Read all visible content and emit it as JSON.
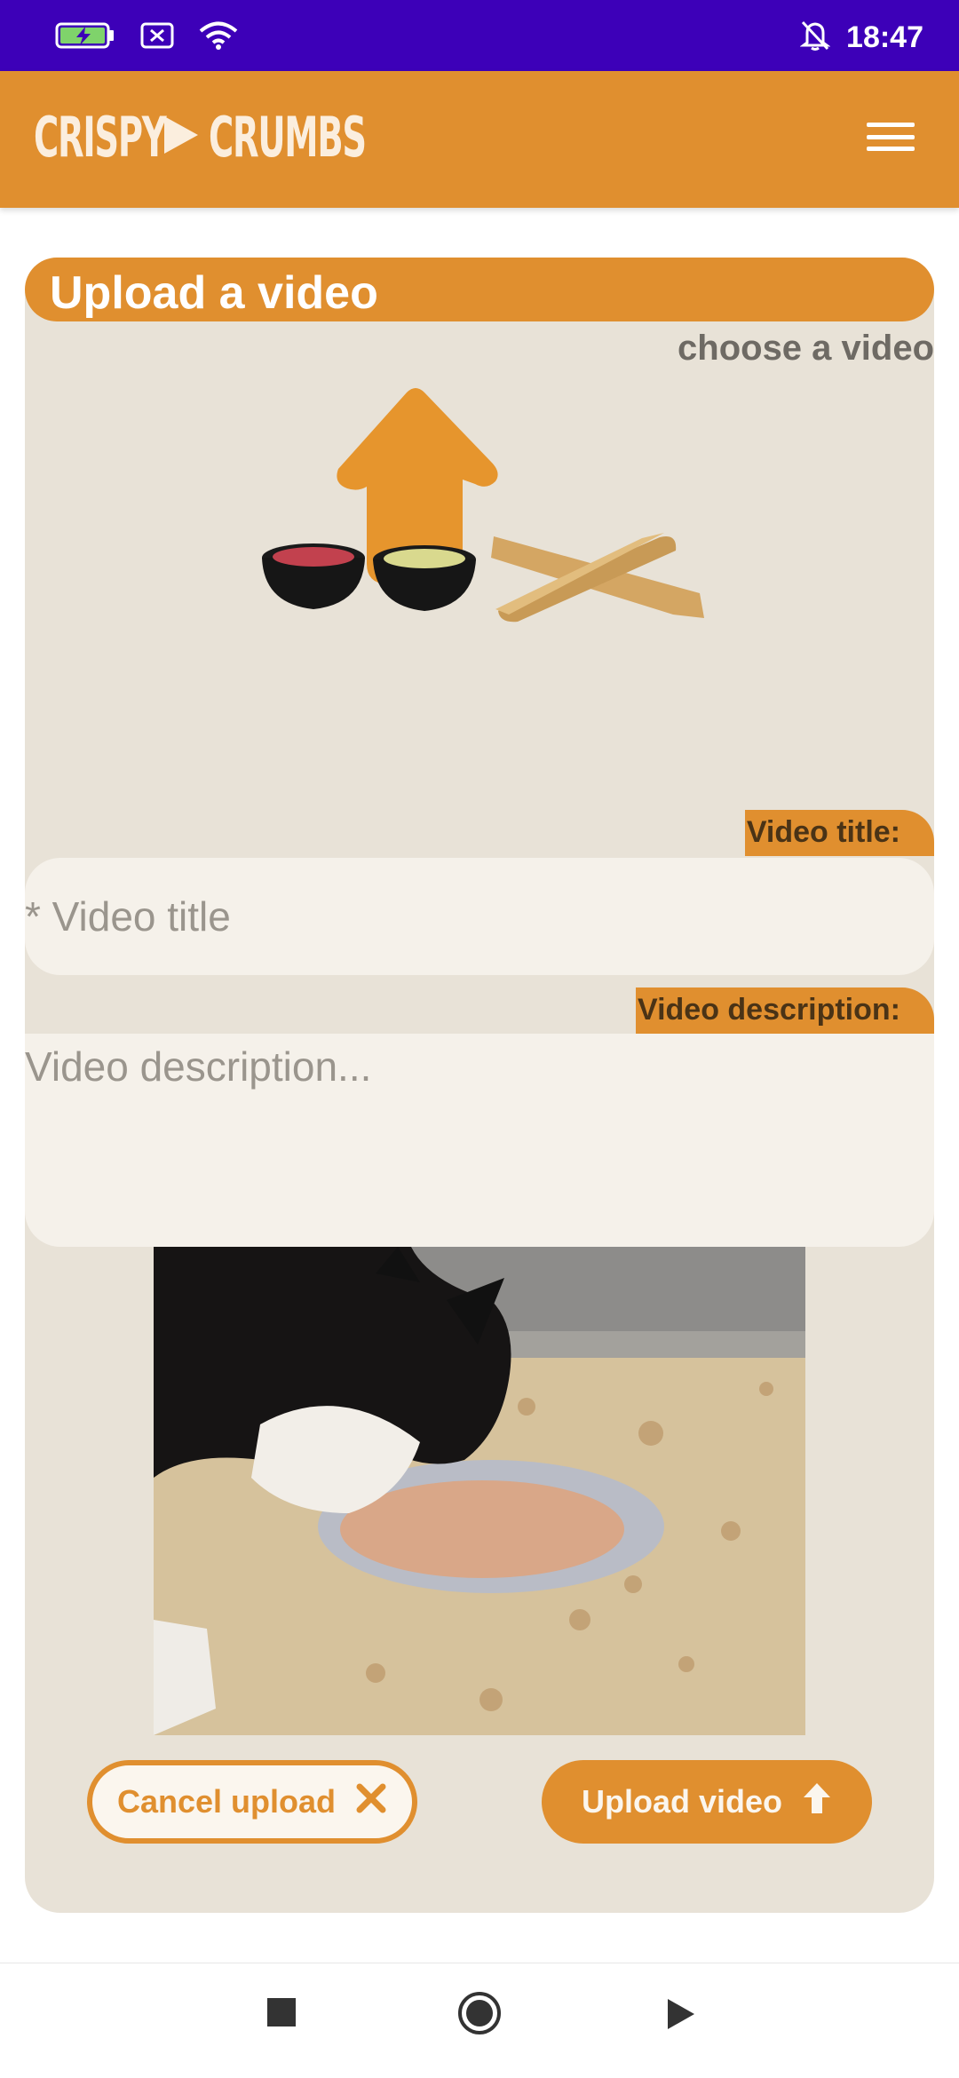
{
  "status_bar": {
    "time": "18:47"
  },
  "header": {
    "logo_left": "CRISPY",
    "logo_right": "CRUMBS"
  },
  "card": {
    "title": "Upload a video",
    "choose_label": "choose a video"
  },
  "form": {
    "title_label": "Video title:",
    "title_placeholder": "* Video title",
    "description_label": "Video description:",
    "description_placeholder": "Video description..."
  },
  "buttons": {
    "cancel": "Cancel upload",
    "upload": "Upload video"
  },
  "colors": {
    "accent": "#e08f2f",
    "status_bar": "#3d00b8",
    "card_bg": "#e8e2d7",
    "field_bg": "#f5f1ea"
  },
  "icons": {
    "battery": "battery-charging-icon",
    "no_sim": "no-sim-icon",
    "wifi": "wifi-icon",
    "notifications_off": "bell-off-icon",
    "menu": "hamburger-menu-icon",
    "upload_arrow": "upload-arrow-icon",
    "cancel": "close-icon",
    "upload": "arrow-up-icon",
    "nav_recents": "square-icon",
    "nav_home": "circle-icon",
    "nav_back": "triangle-icon"
  }
}
